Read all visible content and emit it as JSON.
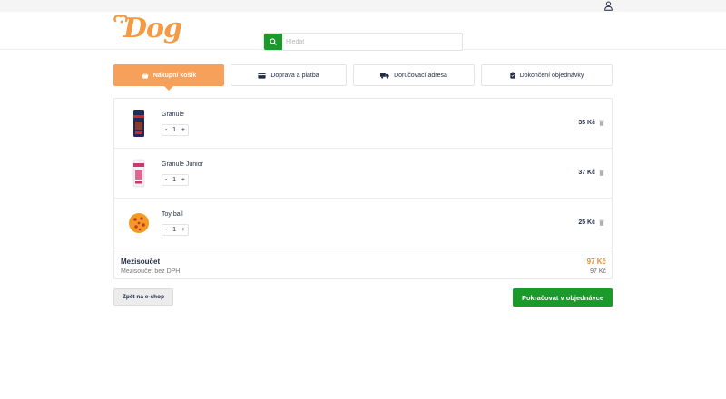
{
  "header": {
    "logo_text": "Dog",
    "search": {
      "placeholder": "Hledat",
      "value": ""
    },
    "icons": {
      "user": "user-icon",
      "search": "search-icon"
    }
  },
  "steps": [
    {
      "label": "Nákupní košík",
      "icon": "basket-icon",
      "active": true
    },
    {
      "label": "Doprava a platba",
      "icon": "card-icon",
      "active": false
    },
    {
      "label": "Doručovací adresa",
      "icon": "truck-icon",
      "active": false
    },
    {
      "label": "Dokončení objednávky",
      "icon": "clipboard-icon",
      "active": false
    }
  ],
  "cart": {
    "items": [
      {
        "name": "Granule",
        "quantity": "1",
        "minus": "-",
        "plus": "+",
        "price": "35 Kč"
      },
      {
        "name": "Granule Junior",
        "quantity": "1",
        "minus": "-",
        "plus": "+",
        "price": "37 Kč"
      },
      {
        "name": "Toy ball",
        "quantity": "1",
        "minus": "-",
        "plus": "+",
        "price": "25 Kč"
      }
    ],
    "subtotal": {
      "label": "Mezisoučet",
      "note": "Mezisoučet bez DPH",
      "value": "97 Kč",
      "value_no_vat": "97 Kč"
    }
  },
  "actions": {
    "back_label": "Zpět na e-shop",
    "continue_label": "Pokračovat v objednávce"
  },
  "colors": {
    "accent": "#f7a05a",
    "brand_orange": "#f08a2c",
    "primary_green": "#1a9a2b",
    "text_dark": "#1f2a44"
  }
}
